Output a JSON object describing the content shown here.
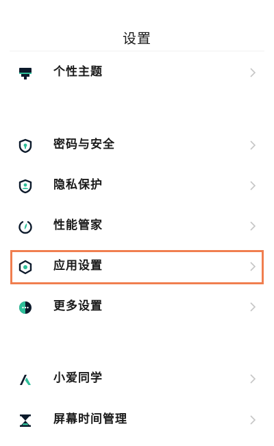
{
  "header": {
    "title": "设置"
  },
  "items": [
    {
      "label": "个性主题",
      "icon": "theme-icon"
    },
    {
      "label": "密码与安全",
      "icon": "shield-lock-icon"
    },
    {
      "label": "隐私保护",
      "icon": "privacy-icon"
    },
    {
      "label": "性能管家",
      "icon": "performance-icon"
    },
    {
      "label": "应用设置",
      "icon": "app-settings-icon"
    },
    {
      "label": "更多设置",
      "icon": "more-settings-icon"
    },
    {
      "label": "小爱同学",
      "icon": "xiaoai-icon"
    },
    {
      "label": "屏幕时间管理",
      "icon": "hourglass-icon"
    }
  ],
  "colors": {
    "icon": "#0c1a2b",
    "accent": "#2fbf9a",
    "highlight": "#f07e4f",
    "chevron": "#c5c5c5"
  }
}
